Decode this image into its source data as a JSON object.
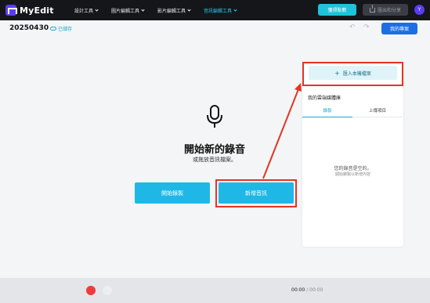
{
  "app": {
    "name": "MyEdit"
  },
  "nav": {
    "items": [
      {
        "label": "設計工具",
        "active": false
      },
      {
        "label": "圖片編輯工具",
        "active": false
      },
      {
        "label": "影片編輯工具",
        "active": false
      },
      {
        "label": "音訊編輯工具",
        "active": true
      }
    ]
  },
  "header": {
    "subscribe_label": "獲得點數",
    "export_label": "匯出和分享",
    "avatar_initial": "Y"
  },
  "subheader": {
    "project_name": "20250430",
    "saved_label": "已儲存",
    "projects_label": "我的專案"
  },
  "main": {
    "title": "開始新的錄音",
    "subtitle": "或拖放音訊檔案。",
    "record_label": "開始錄製",
    "add_audio_label": "新增音訊"
  },
  "panel": {
    "import_label": "匯入本機檔案",
    "library_title": "我的雲端媒體庫",
    "tabs": [
      {
        "label": "錄製",
        "active": true
      },
      {
        "label": "上傳項目",
        "active": false
      }
    ],
    "empty_title": "您的錄音是空的。",
    "empty_sub": "開始錄製以新增內容"
  },
  "player": {
    "current": "00:00",
    "total": " / 00:00"
  },
  "colors": {
    "accent": "#1fb8e6",
    "highlight": "#e53325",
    "brand": "#5b3cf0"
  }
}
